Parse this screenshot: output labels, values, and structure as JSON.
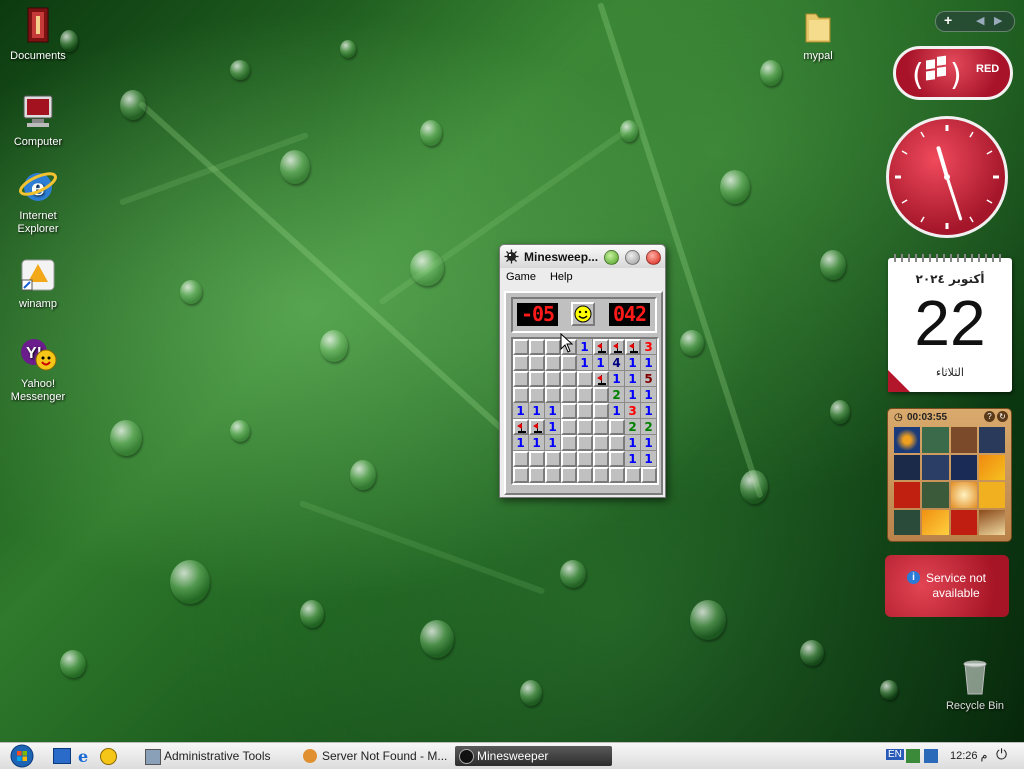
{
  "desktop": {
    "icons": [
      {
        "label": "Documents",
        "icon": "documents-icon"
      },
      {
        "label": "Computer",
        "icon": "computer-icon"
      },
      {
        "label": "Internet Explorer",
        "icon": "internet-explorer-icon"
      },
      {
        "label": "winamp",
        "icon": "winamp-icon"
      },
      {
        "label": "Yahoo! Messenger",
        "icon": "yahoo-messenger-icon"
      },
      {
        "label": "mypal",
        "icon": "folder-icon"
      },
      {
        "label": "Recycle Bin",
        "icon": "recycle-bin-icon"
      }
    ]
  },
  "minesweeper": {
    "title": "Minesweep...",
    "menu": [
      "Game",
      "Help"
    ],
    "mine_counter": "-05",
    "timer": "042",
    "face": "smiley",
    "grid": [
      [
        "",
        "",
        "",
        "",
        "1",
        "F",
        "F",
        "F",
        "3"
      ],
      [
        "",
        "",
        "",
        "",
        "1",
        "1",
        "4",
        "1",
        "1"
      ],
      [
        "",
        "",
        "",
        "",
        "",
        "F",
        "1",
        "1",
        "5"
      ],
      [
        "",
        "",
        "",
        "",
        "",
        "",
        "2",
        "1",
        "1"
      ],
      [
        "1",
        "1",
        "1",
        "",
        "",
        "",
        "1",
        "3",
        "1"
      ],
      [
        "F",
        "F",
        "1",
        "",
        "",
        "",
        "",
        "2",
        "2"
      ],
      [
        "1",
        "1",
        "1",
        "",
        "",
        "",
        "",
        "1",
        "1"
      ],
      [
        "",
        "",
        "",
        "",
        "",
        "",
        "",
        "1",
        "1"
      ],
      [
        "",
        "",
        "",
        "",
        "",
        "",
        "",
        "",
        ""
      ]
    ],
    "number_colors": {
      "1": "#0000ff",
      "2": "#008000",
      "3": "#ff0000",
      "4": "#000080",
      "5": "#800000"
    }
  },
  "gadgets": {
    "red_label": "RED",
    "clock": {
      "hour": 11,
      "minute": 27
    },
    "calendar": {
      "month_year": "أكتوبر ٢٠٢٤",
      "day": "22",
      "weekday": "الثلاثاء"
    },
    "puzzle_timer": "00:03:55",
    "weather_message": "Service not available"
  },
  "taskbar": {
    "tasks": [
      {
        "label": "Administrative Tools",
        "active": false
      },
      {
        "label": "Server Not Found - M...",
        "active": false
      },
      {
        "label": "Minesweeper",
        "active": true
      }
    ],
    "language": "EN",
    "time": "12:26 م"
  },
  "colors": {
    "accent_red": "#b01c2e",
    "lcd_red": "#ff1a1a"
  }
}
